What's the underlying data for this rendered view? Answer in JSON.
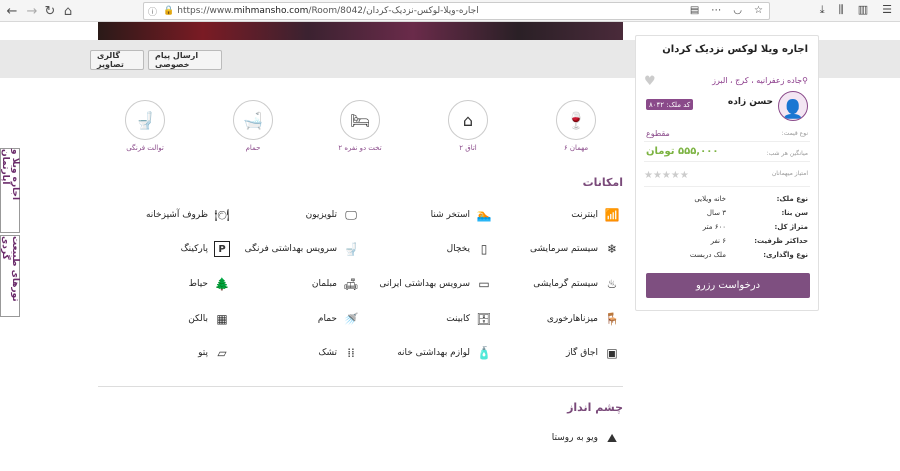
{
  "browser": {
    "url_base": "https://www.",
    "url_domain": "mihmansho.com",
    "url_path": "/Room/8042/",
    "url_slug": "اجاره-ویلا-لوکس-نزدیک-کردان",
    "icons": [
      "back-icon",
      "forward-icon",
      "reload-icon",
      "home-icon",
      "reader-icon",
      "pocket-icon",
      "bookmark-star-icon",
      "download-icon",
      "library-icon",
      "sidebar-icon",
      "menu-icon"
    ]
  },
  "buttons": {
    "gallery": "گالری تصاویر",
    "message": "ارسال پیام خصوصی"
  },
  "side_tabs": {
    "rent": "اجاره ویلا و آپارتمان",
    "tours": "تورهای طبیعت گردی"
  },
  "features": [
    {
      "icon": "guests-icon",
      "label": "۶ مهمان",
      "glyph": "🍷"
    },
    {
      "icon": "rooms-icon",
      "label": "۲ اتاق",
      "glyph": "⌂"
    },
    {
      "icon": "bed-icon",
      "label": "۲ تخت دو نفره",
      "glyph": "🛏"
    },
    {
      "icon": "bath-icon",
      "label": "حمام",
      "glyph": "🛁"
    },
    {
      "icon": "toilet-icon",
      "label": "توالت فرنگی",
      "glyph": "🚽"
    }
  ],
  "amenities_title": "امکانات",
  "amenities": [
    {
      "label": "اینترنت",
      "glyph": "📶",
      "icon": "wifi-icon"
    },
    {
      "label": "استخر شنا",
      "glyph": "🏊",
      "icon": "pool-icon"
    },
    {
      "label": "تلویزیون",
      "glyph": "🖵",
      "icon": "tv-icon"
    },
    {
      "label": "ظروف آشپزخانه",
      "glyph": "🍽",
      "icon": "dishes-icon"
    },
    {
      "label": "سیستم سرمایشی",
      "glyph": "❄",
      "icon": "ac-icon"
    },
    {
      "label": "یخچال",
      "glyph": "▯",
      "icon": "fridge-icon"
    },
    {
      "label": "سرویس بهداشتی فرنگی",
      "glyph": "🚽",
      "icon": "western-toilet-icon"
    },
    {
      "label": "پارکینگ",
      "glyph": "P",
      "icon": "parking-icon"
    },
    {
      "label": "سیستم گرمایشی",
      "glyph": "♨",
      "icon": "heater-icon"
    },
    {
      "label": "سرویس بهداشتی ایرانی",
      "glyph": "▭",
      "icon": "iranian-toilet-icon"
    },
    {
      "label": "مبلمان",
      "glyph": "🛋",
      "icon": "sofa-icon"
    },
    {
      "label": "حیاط",
      "glyph": "🌲",
      "icon": "yard-icon"
    },
    {
      "label": "میزناهارخوری",
      "glyph": "🪑",
      "icon": "dining-table-icon"
    },
    {
      "label": "کابینت",
      "glyph": "🗄",
      "icon": "cabinet-icon"
    },
    {
      "label": "حمام",
      "glyph": "🚿",
      "icon": "shower-icon"
    },
    {
      "label": "بالکن",
      "glyph": "▦",
      "icon": "balcony-icon"
    },
    {
      "label": "اجاق گاز",
      "glyph": "▣",
      "icon": "stove-icon"
    },
    {
      "label": "لوازم بهداشتی خانه",
      "glyph": "🧴",
      "icon": "toiletries-icon"
    },
    {
      "label": "تشک",
      "glyph": "⁞⁞",
      "icon": "mattress-icon"
    },
    {
      "label": "پتو",
      "glyph": "▱",
      "icon": "blanket-icon"
    }
  ],
  "view_title": "چشم انداز",
  "view_items": [
    {
      "label": "ویو به روستا",
      "glyph": "⛰",
      "icon": "village-view-icon"
    }
  ],
  "card": {
    "title": "اجاره ویلا لوکس نزدیک کردان",
    "location": "جاده زعفرانیه ، کرج ، البرز",
    "host": "حسن زاده",
    "code": "کد ملک: ۸۰۴۲",
    "price_type_label": "نوع قیمت:",
    "price_type": "مقطوع",
    "price_label": "میانگین هر شب:",
    "price": "۵۵۵,۰۰۰ تومان",
    "rating_label": "امتیاز میهمانان",
    "stars": "★★★★★",
    "specs": [
      {
        "key": "نوع ملک:",
        "value": "خانه ویلایی"
      },
      {
        "key": "سن بنا:",
        "value": "۳ سال"
      },
      {
        "key": "متراژ کل:",
        "value": "۶۰۰ متر"
      },
      {
        "key": "حداکثر ظرفیت:",
        "value": "۶ نفر"
      },
      {
        "key": "نوع واگذاری:",
        "value": "ملک دربست"
      }
    ],
    "reserve": "درخواست رزرو"
  },
  "colors": {
    "accent": "#7e4f80",
    "price": "#7cb342",
    "label": "#8a4a8a"
  }
}
